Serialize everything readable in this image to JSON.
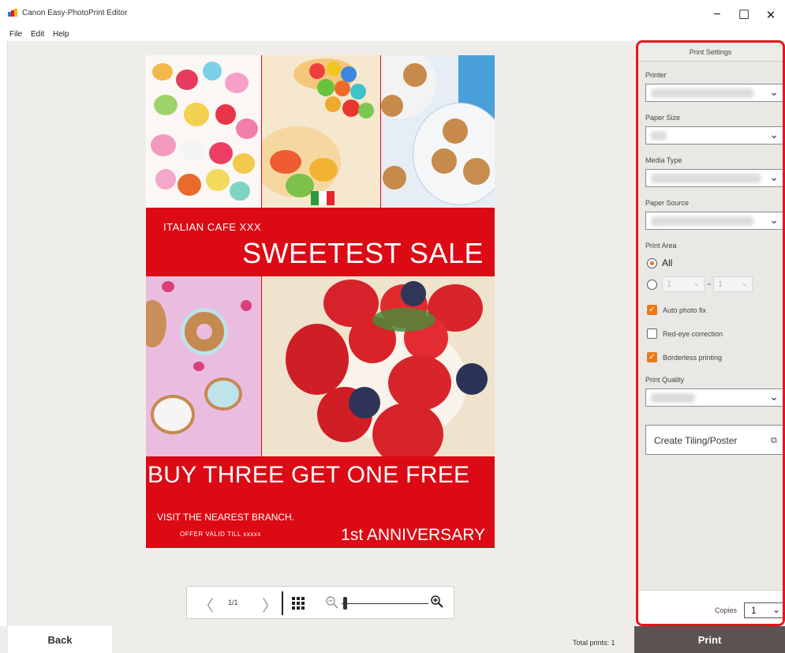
{
  "app": {
    "title": "Canon Easy-PhotoPrint Editor",
    "window_controls": [
      "−",
      "☐",
      "✕"
    ]
  },
  "menu": [
    "File",
    "Edit",
    "Help"
  ],
  "poster": {
    "cafe": "ITALIAN CAFE XXX",
    "headline": "SWEETEST SALE",
    "promo": "BUY THREE GET ONE FREE",
    "visit": "VISIT THE NEAREST BRANCH.",
    "offer": "OFFER VALID TILL xxxxx",
    "anniversary": "1st ANNIVERSARY",
    "accent_color": "#dc0a14"
  },
  "toolbar": {
    "prev": "〈",
    "page": "1/1",
    "next": "〉",
    "zoom_level": 0.05
  },
  "bottom": {
    "back_label": "Back",
    "total_prints": "Total prints: 1",
    "print_label": "Print"
  },
  "settings": {
    "header": "Print Settings",
    "printer_label": "Printer",
    "paper_size_label": "Paper Size",
    "media_type_label": "Media Type",
    "paper_source_label": "Paper Source",
    "print_area_label": "Print Area",
    "all_label": "All",
    "range_from": "1",
    "range_sep": "-",
    "range_to": "1",
    "auto_photo_fix": "Auto photo fix",
    "red_eye": "Red-eye correction",
    "borderless": "Borderless printing",
    "print_quality_label": "Print Quality",
    "tiling_button": "Create Tiling/Poster",
    "copies_label": "Copies",
    "copies_value": "1",
    "highlight_color": "#e8141c",
    "checkbox_color": "#e87a18"
  }
}
